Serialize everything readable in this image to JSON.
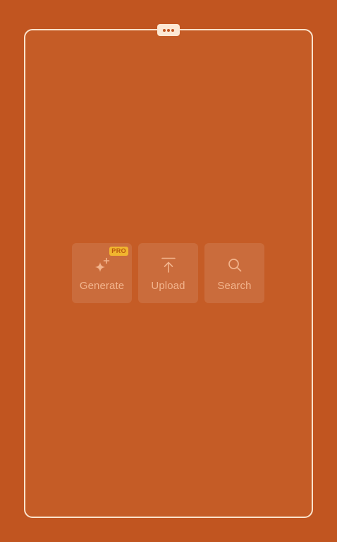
{
  "window": {
    "menu_icon": "ellipsis-icon"
  },
  "actions": [
    {
      "label": "Generate",
      "icon": "sparkles-icon",
      "badge": "PRO"
    },
    {
      "label": "Upload",
      "icon": "upload-icon"
    },
    {
      "label": "Search",
      "icon": "search-icon"
    }
  ],
  "colors": {
    "background": "#c15520",
    "frame_border": "#fbe3cc",
    "badge": "#f1b52f",
    "label": "#f2b48d"
  }
}
